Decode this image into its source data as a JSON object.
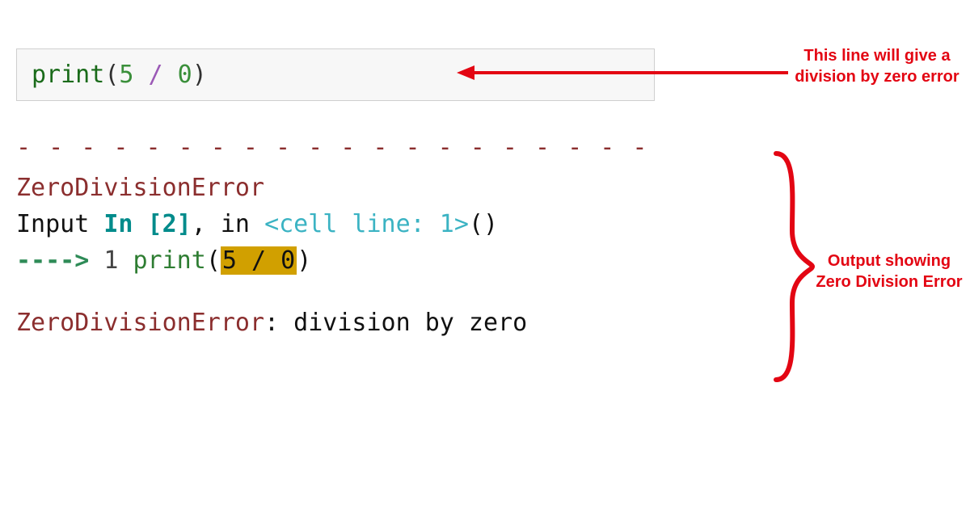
{
  "code": {
    "func": "print",
    "lparen": "(",
    "num_a": "5",
    "space1": " ",
    "op": "/",
    "space2": " ",
    "num_b": "0",
    "rparen": ")"
  },
  "separator": "- - - - - - - - - - - - - - - - - - - - - - - - - - - - - - - - - - - - - - -",
  "traceback": {
    "err_name": "ZeroDivisionError",
    "input_prefix": "Input ",
    "in_label": "In [2]",
    "comma_in": ", in ",
    "cell_line": "<cell line: 1>",
    "parens": "()",
    "arrow": "----> ",
    "lineno": "1",
    "sp": " ",
    "print_word": "print",
    "lparen": "(",
    "hl_expr": "5 / 0",
    "rparen": ")",
    "final_err": "ZeroDivisionError",
    "final_colon": ": ",
    "final_msg": "division by zero"
  },
  "annotations": {
    "line1": "This line will give a division by zero error",
    "line2": "Output showing Zero Division Error"
  },
  "colors": {
    "annotation_red": "#e30613",
    "err_color": "#8b2e2e",
    "highlight_bg": "#d1a000"
  }
}
